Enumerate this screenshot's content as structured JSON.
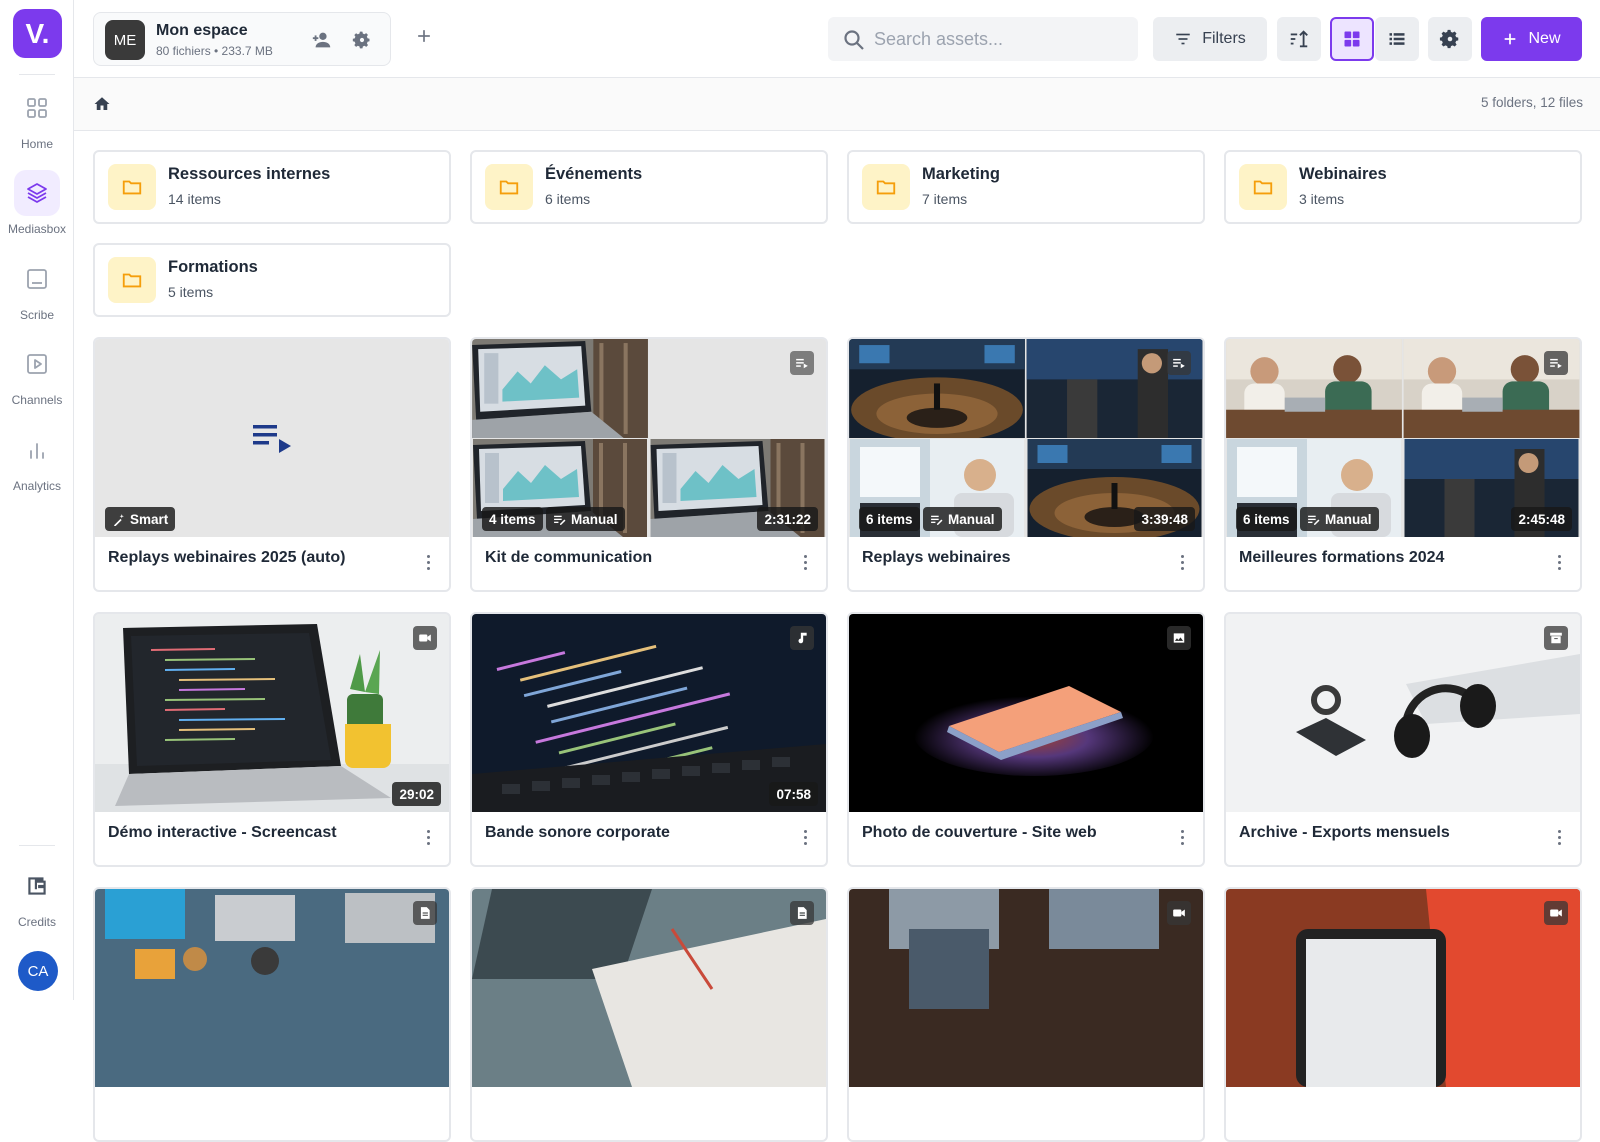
{
  "sidebar": {
    "logo": "V.",
    "items": [
      {
        "label": "Home",
        "icon": "grid-icon"
      },
      {
        "label": "Mediasbox",
        "icon": "layers-icon",
        "active": true
      },
      {
        "label": "Scribe",
        "icon": "transcript-icon"
      },
      {
        "label": "Channels",
        "icon": "play-square-icon"
      },
      {
        "label": "Analytics",
        "icon": "bar-chart-icon"
      }
    ],
    "credits_label": "Credits",
    "avatar": "CA"
  },
  "workspace": {
    "initials": "ME",
    "name": "Mon espace",
    "meta": "80 fichiers • 233.7 MB"
  },
  "search": {
    "placeholder": "Search assets..."
  },
  "toolbar": {
    "filters_label": "Filters",
    "new_label": "New"
  },
  "breadcrumb": {
    "summary": "5 folders, 12 files"
  },
  "folders": [
    {
      "name": "Ressources internes",
      "count": "14 items"
    },
    {
      "name": "Événements",
      "count": "6 items"
    },
    {
      "name": "Marketing",
      "count": "7 items"
    },
    {
      "name": "Webinaires",
      "count": "3 items"
    },
    {
      "name": "Formations",
      "count": "5 items"
    }
  ],
  "playlists": [
    {
      "title": "Replays webinaires 2025 (auto)",
      "mode": "Smart"
    },
    {
      "title": "Kit de communication",
      "items": "4 items",
      "mode": "Manual",
      "duration": "2:31:22"
    },
    {
      "title": "Replays webinaires",
      "items": "6 items",
      "mode": "Manual",
      "duration": "3:39:48"
    },
    {
      "title": "Meilleures formations 2024",
      "items": "6 items",
      "mode": "Manual",
      "duration": "2:45:48"
    }
  ],
  "files": [
    {
      "title": "Démo interactive - Screencast",
      "type": "video",
      "duration": "29:02"
    },
    {
      "title": "Bande sonore corporate",
      "type": "audio",
      "duration": "07:58"
    },
    {
      "title": "Photo de couverture - Site web",
      "type": "image"
    },
    {
      "title": "Archive - Exports mensuels",
      "type": "archive"
    },
    {
      "title": "",
      "type": "document"
    },
    {
      "title": "",
      "type": "document"
    },
    {
      "title": "",
      "type": "video"
    },
    {
      "title": "",
      "type": "video"
    }
  ],
  "colors": {
    "accent": "#7c3aed",
    "avatar": "#1e5ac8",
    "folder_bg": "#fef3c7",
    "folder_icon": "#f59e0b"
  }
}
